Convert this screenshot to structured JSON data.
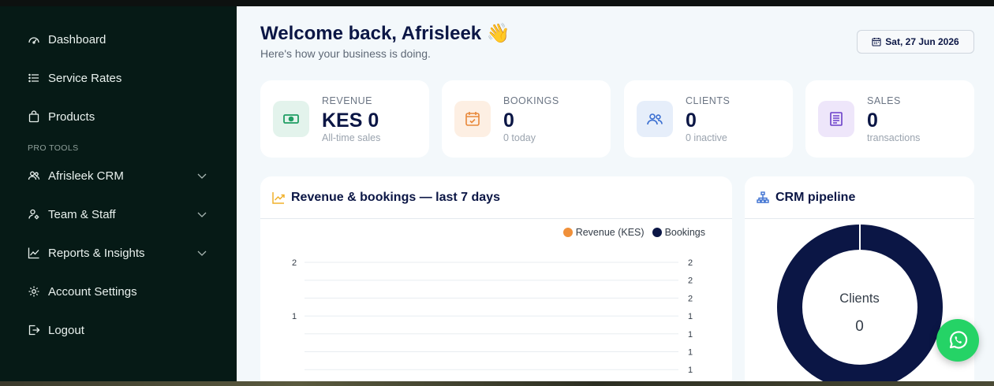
{
  "sidebar": {
    "items": [
      {
        "label": "Dashboard",
        "icon": "gauge-icon"
      },
      {
        "label": "Service Rates",
        "icon": "list-icon"
      },
      {
        "label": "Products",
        "icon": "bag-icon"
      }
    ],
    "section_label": "PRO TOOLS",
    "pro_items": [
      {
        "label": "Afrisleek CRM",
        "icon": "users-icon"
      },
      {
        "label": "Team & Staff",
        "icon": "user-gear-icon"
      },
      {
        "label": "Reports & Insights",
        "icon": "chart-line-icon"
      },
      {
        "label": "Account Settings",
        "icon": "gear-icon"
      },
      {
        "label": "Logout",
        "icon": "logout-icon"
      }
    ]
  },
  "header": {
    "welcome": "Welcome back, Afrisleek 👋",
    "subtitle": "Here's how your business is doing.",
    "date": "Sat, 27 Jun 2026"
  },
  "stats": [
    {
      "label": "REVENUE",
      "value": "KES 0",
      "sub": "All-time sales",
      "color": "#1f9d63",
      "bg": "#e3f3ec"
    },
    {
      "label": "BOOKINGS",
      "value": "0",
      "sub": "0 today",
      "color": "#e8883a",
      "bg": "#fdefe3"
    },
    {
      "label": "CLIENTS",
      "value": "0",
      "sub": "0 inactive",
      "color": "#3b6fd1",
      "bg": "#e6eefa"
    },
    {
      "label": "SALES",
      "value": "0",
      "sub": "transactions",
      "color": "#6a3fc9",
      "bg": "#eee6fa"
    }
  ],
  "revenue_panel": {
    "title": "Revenue & bookings — last 7 days",
    "legend": [
      {
        "name": "Revenue (KES)",
        "color": "#f0903a"
      },
      {
        "name": "Bookings",
        "color": "#0b1645"
      }
    ]
  },
  "chart_data": {
    "type": "line",
    "series": [
      {
        "name": "Revenue (KES)",
        "values": []
      },
      {
        "name": "Bookings",
        "values": []
      }
    ],
    "left_ticks": [
      "2",
      "1"
    ],
    "right_ticks": [
      "2",
      "2",
      "2",
      "1",
      "1",
      "1",
      "1"
    ],
    "grid": true
  },
  "crm_panel": {
    "title": "CRM pipeline",
    "center_label": "Clients",
    "center_value": "0",
    "ring_color": "#0b1645"
  },
  "whatsapp": {
    "icon": "whatsapp-icon"
  }
}
